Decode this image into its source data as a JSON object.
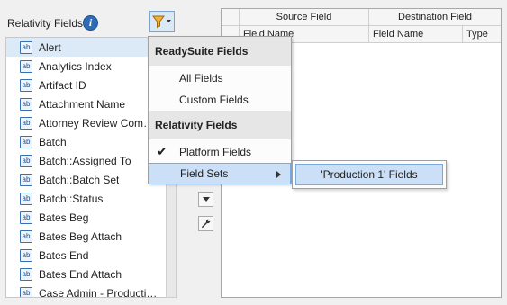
{
  "left_panel": {
    "title": "Relativity Fields",
    "info_icon": "i",
    "fields": [
      {
        "label": "Alert",
        "icon": "ab"
      },
      {
        "label": "Analytics Index",
        "icon": "ab"
      },
      {
        "label": "Artifact ID",
        "icon": "ab"
      },
      {
        "label": "Attachment Name",
        "icon": "ab"
      },
      {
        "label": "Attorney Review Comments",
        "icon": "ab"
      },
      {
        "label": "Batch",
        "icon": "ab"
      },
      {
        "label": "Batch::Assigned To",
        "icon": "ab"
      },
      {
        "label": "Batch::Batch Set",
        "icon": "ab"
      },
      {
        "label": "Batch::Status",
        "icon": "ab"
      },
      {
        "label": "Bates Beg",
        "icon": "ab"
      },
      {
        "label": "Bates Beg Attach",
        "icon": "ab"
      },
      {
        "label": "Bates End",
        "icon": "ab"
      },
      {
        "label": "Bates End Attach",
        "icon": "ab"
      },
      {
        "label": "Case Admin - Production ...",
        "icon": "ab"
      }
    ]
  },
  "grid": {
    "group_headers": [
      "Source Field",
      "Destination Field"
    ],
    "columns": [
      "Field Name",
      "Field Name",
      "Type"
    ]
  },
  "menu": {
    "section1": "ReadySuite Fields",
    "all_fields": "All Fields",
    "custom_fields": "Custom Fields",
    "section2": "Relativity Fields",
    "platform_fields": "Platform Fields",
    "field_sets": "Field Sets",
    "check": "✔"
  },
  "submenu": {
    "item": "'Production 1' Fields"
  },
  "colors": {
    "accent": "#7aa9dd",
    "highlight": "#cbdff6",
    "selected_row": "#dce9f7"
  }
}
